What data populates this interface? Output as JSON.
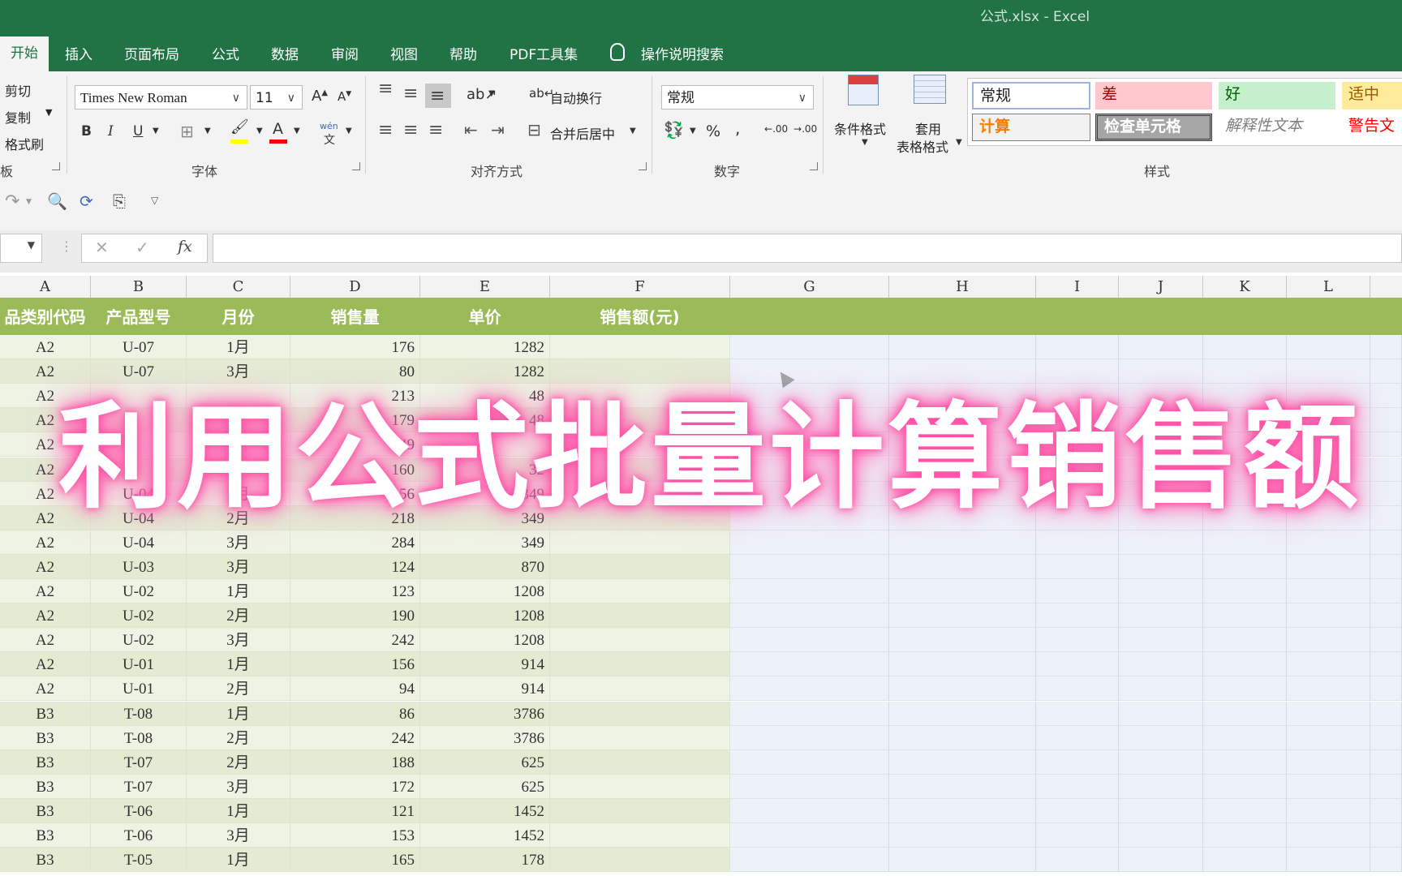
{
  "window": {
    "title": "公式.xlsx  -  Excel"
  },
  "tabs": [
    "开始",
    "插入",
    "页面布局",
    "公式",
    "数据",
    "审阅",
    "视图",
    "帮助",
    "PDF工具集",
    "操作说明搜索"
  ],
  "clipboard": {
    "cut": "剪切",
    "copy": "复制",
    "format_painter": "格式刷",
    "label": "板"
  },
  "font": {
    "name": "Times New Roman",
    "size": "11",
    "grow": "A",
    "shrink": "A",
    "bold": "B",
    "italic": "I",
    "underline": "U",
    "fill_letter": "A",
    "phonetic_top": "wén",
    "phonetic_bottom": "文",
    "label": "字体"
  },
  "alignment": {
    "wrap_text": "自动换行",
    "merge_center": "合并后居中",
    "label": "对齐方式"
  },
  "number": {
    "format": "常规",
    "percent": "%",
    "comma": ",",
    "inc_decimal": ".00",
    "dec_decimal": ".00",
    "label": "数字"
  },
  "styles_group": {
    "conditional": "条件格式",
    "table_line1": "套用",
    "table_line2": "表格格式",
    "cells": [
      "常规",
      "差",
      "好",
      "适中",
      "计算",
      "检查单元格",
      "解释性文本",
      "警告文"
    ],
    "label": "样式",
    "colors": {
      "bad": "#ffc7ce",
      "good": "#c6efce",
      "neutral": "#ffeb9c",
      "calc": "#f2f2f2",
      "check": "#a5a5a5"
    }
  },
  "formula_bar": {
    "cancel": "✕",
    "enter": "✓",
    "fx": "fx",
    "value": ""
  },
  "columns": [
    "A",
    "B",
    "C",
    "D",
    "E",
    "F",
    "G",
    "H",
    "I",
    "J",
    "K",
    "L"
  ],
  "sheet": {
    "headers": [
      "品类别代码",
      "产品型号",
      "月份",
      "销售量",
      "单价",
      "销售额(元)"
    ],
    "rows": [
      [
        "A2",
        "U-07",
        "1月",
        "176",
        "1282",
        ""
      ],
      [
        "A2",
        "U-07",
        "3月",
        "80",
        "1282",
        ""
      ],
      [
        "A2",
        "",
        "",
        "213",
        "48",
        ""
      ],
      [
        "A2",
        "",
        "",
        "179",
        "48",
        ""
      ],
      [
        "A2",
        "",
        "",
        "149",
        "",
        ""
      ],
      [
        "A2",
        "",
        "",
        "160",
        "32",
        ""
      ],
      [
        "A2",
        "U-04",
        "1月",
        "156",
        "349",
        ""
      ],
      [
        "A2",
        "U-04",
        "2月",
        "218",
        "349",
        ""
      ],
      [
        "A2",
        "U-04",
        "3月",
        "284",
        "349",
        ""
      ],
      [
        "A2",
        "U-03",
        "3月",
        "124",
        "870",
        ""
      ],
      [
        "A2",
        "U-02",
        "1月",
        "123",
        "1208",
        ""
      ],
      [
        "A2",
        "U-02",
        "2月",
        "190",
        "1208",
        ""
      ],
      [
        "A2",
        "U-02",
        "3月",
        "242",
        "1208",
        ""
      ],
      [
        "A2",
        "U-01",
        "1月",
        "156",
        "914",
        ""
      ],
      [
        "A2",
        "U-01",
        "2月",
        "94",
        "914",
        ""
      ],
      [
        "B3",
        "T-08",
        "1月",
        "86",
        "3786",
        ""
      ],
      [
        "B3",
        "T-08",
        "2月",
        "242",
        "3786",
        ""
      ],
      [
        "B3",
        "T-07",
        "2月",
        "188",
        "625",
        ""
      ],
      [
        "B3",
        "T-07",
        "3月",
        "172",
        "625",
        ""
      ],
      [
        "B3",
        "T-06",
        "1月",
        "121",
        "1452",
        ""
      ],
      [
        "B3",
        "T-06",
        "3月",
        "153",
        "1452",
        ""
      ],
      [
        "B3",
        "T-05",
        "1月",
        "165",
        "178",
        ""
      ]
    ],
    "row_colors": [
      "#eef3e4",
      "#e3ebd3"
    ]
  },
  "overlay_caption": "利用公式批量计算销售额"
}
